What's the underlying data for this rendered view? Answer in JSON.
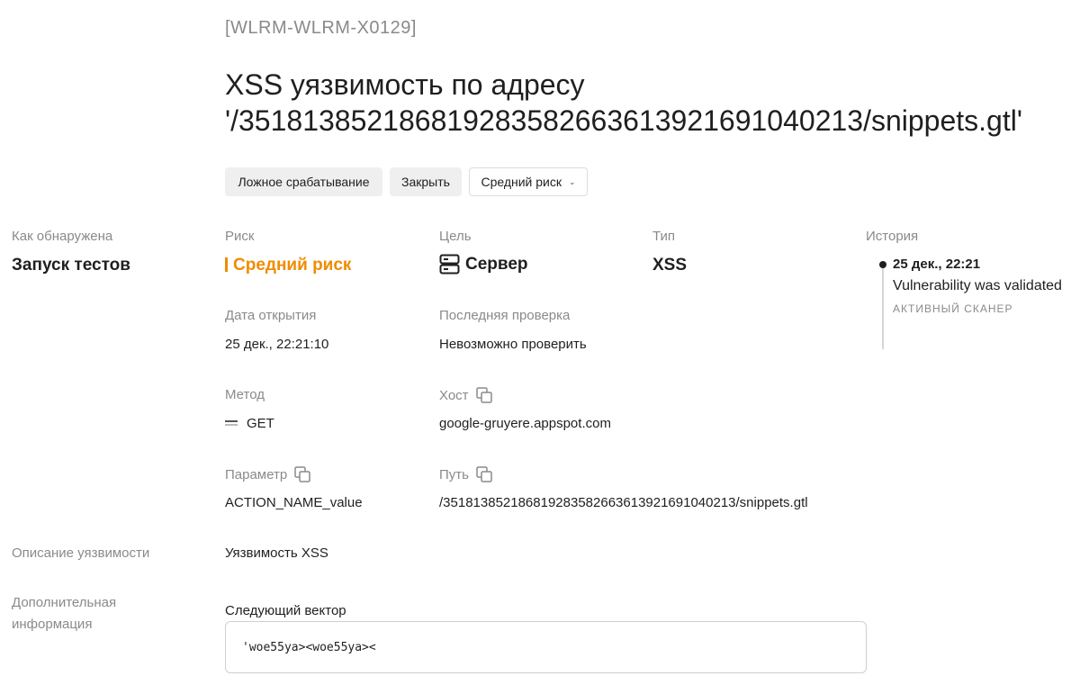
{
  "issue": {
    "id": "[WLRM-WLRM-X0129]",
    "title": "XSS уязвимость по адресу '/351813852186819283582663613921691040213/snippets.gtl'"
  },
  "actions": {
    "false_positive": "Ложное срабатывание",
    "close": "Закрыть",
    "risk_dropdown": "Средний риск"
  },
  "details": {
    "detected_label": "Как обнаружена",
    "detected_value": "Запуск тестов",
    "risk_label": "Риск",
    "risk_value": "Средний риск",
    "risk_color": "#f08c00",
    "target_label": "Цель",
    "target_value": "Сервер",
    "type_label": "Тип",
    "type_value": "XSS",
    "opened_label": "Дата открытия",
    "opened_value": "25 дек., 22:21:10",
    "last_check_label": "Последняя проверка",
    "last_check_value": "Невозможно проверить",
    "method_label": "Метод",
    "method_value": "GET",
    "host_label": "Хост",
    "host_value": "google-gruyere.appspot.com",
    "param_label": "Параметр",
    "param_value": "ACTION_NAME_value",
    "path_label": "Путь",
    "path_value": "/351813852186819283582663613921691040213/snippets.gtl"
  },
  "history": {
    "label": "История",
    "events": [
      {
        "time": "25 дек., 22:21",
        "text": "Vulnerability was validated",
        "source": "АКТИВНЫЙ СКАНЕР"
      }
    ]
  },
  "description": {
    "label": "Описание уязвимости",
    "value": "Уязвимость XSS"
  },
  "additional": {
    "label_line1": "Дополнительная",
    "label_line2": "информация",
    "vector_label": "Следующий вектор",
    "vector_value": "'woe55ya><woe55ya><"
  },
  "icons": {
    "copy": "copy-icon",
    "server": "server-icon",
    "method": "method-icon",
    "dropdown": "chevron-down-icon"
  }
}
